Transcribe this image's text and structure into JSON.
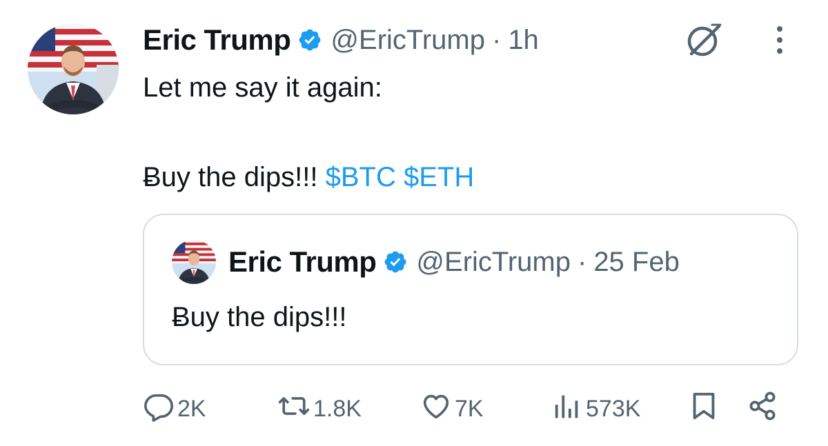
{
  "tweet": {
    "author_name": "Eric Trump",
    "handle": "@EricTrump",
    "separator": "·",
    "time": "1h",
    "text_line1": "Let me say it again:",
    "text_line2_plain": "Ƀuy the dips!!! ",
    "cashtags": [
      "$BTC",
      "$ETH"
    ]
  },
  "quoted": {
    "author_name": "Eric Trump",
    "handle": "@EricTrump",
    "separator": "·",
    "date": "25 Feb",
    "text": "Ƀuy the dips!!!"
  },
  "actions": {
    "replies": "2K",
    "reposts": "1.8K",
    "likes": "7K",
    "views": "573K"
  },
  "colors": {
    "accent": "#1d9bf0",
    "muted": "#536471",
    "text": "#0f1419",
    "border": "#d6dde2"
  },
  "icons": [
    "verified-badge-icon",
    "grok-icon",
    "more-icon",
    "reply-icon",
    "repost-icon",
    "like-icon",
    "views-icon",
    "bookmark-icon",
    "share-icon"
  ]
}
